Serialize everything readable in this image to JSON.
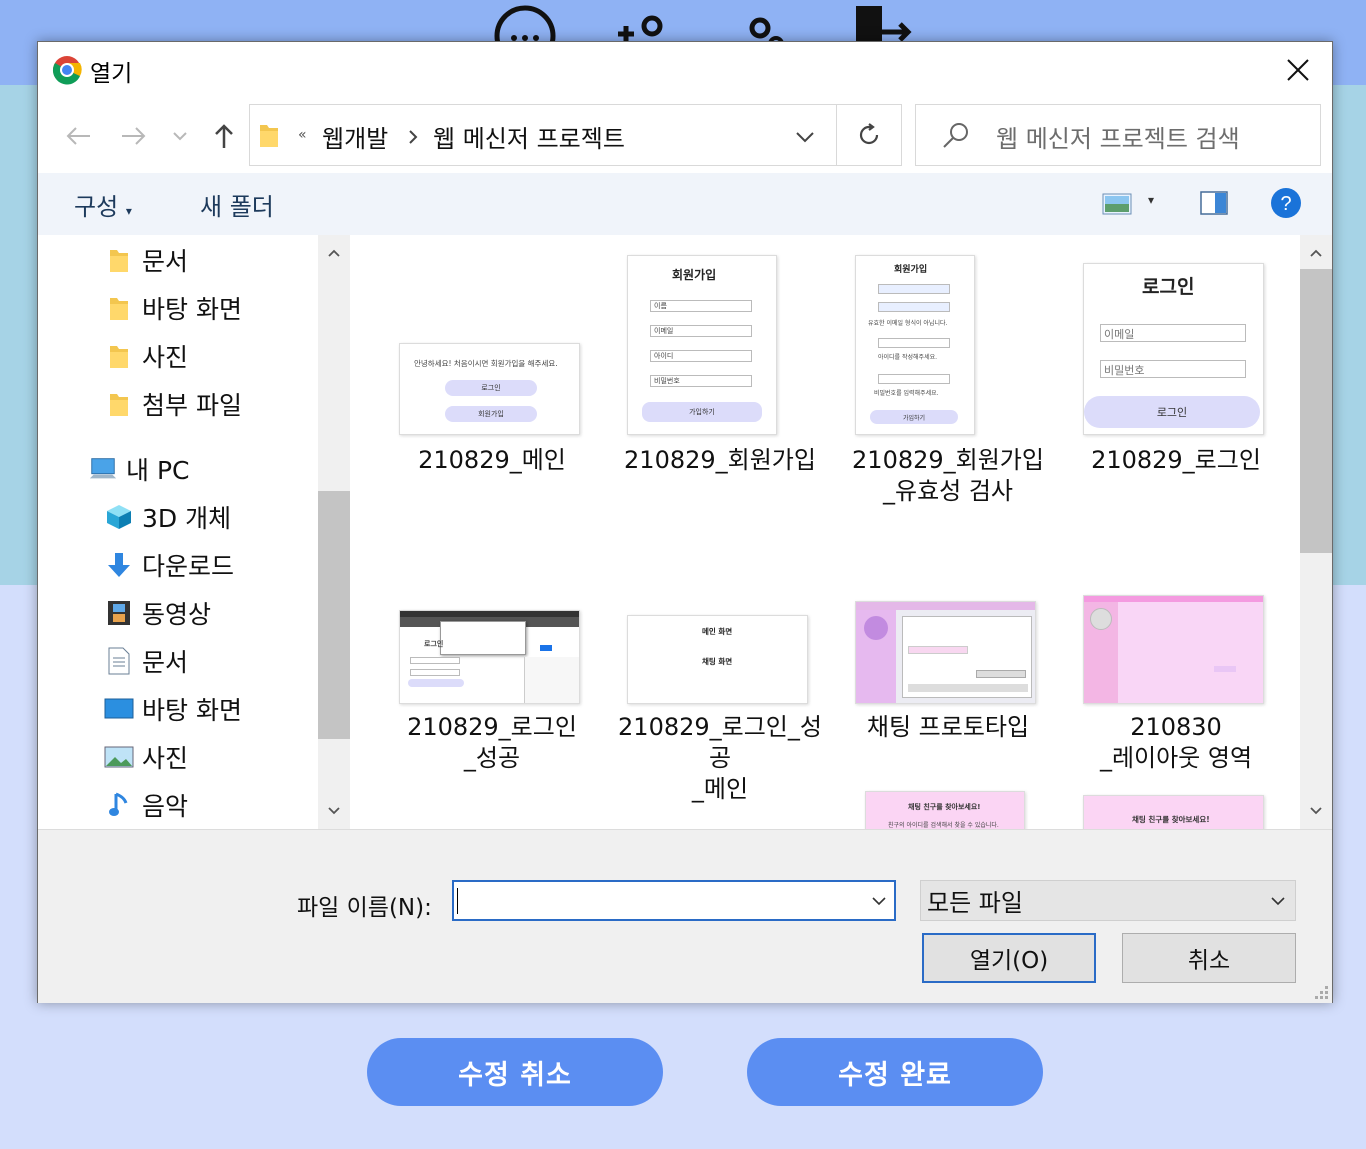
{
  "background": {
    "icons": [
      "chat-bubble-icon",
      "add-friend-icon",
      "user-settings-icon",
      "logout-icon"
    ],
    "buttons": {
      "cancel_edit": "수정 취소",
      "complete_edit": "수정 완료"
    }
  },
  "dialog": {
    "title": "열기",
    "breadcrumb": {
      "overflow": "«",
      "parent": "웹개발",
      "current": "웹 메신저 프로젝트"
    },
    "search_placeholder": "웹 메신저 프로젝트 검색",
    "commands": {
      "organize": "구성",
      "new_folder": "새 폴더"
    },
    "nav_items": {
      "documents_quick": "문서",
      "desktop_quick": "바탕 화면",
      "pictures_quick": "사진",
      "attachments": "첨부 파일",
      "this_pc": "내 PC",
      "objects_3d": "3D 개체",
      "downloads": "다운로드",
      "videos": "동영상",
      "documents": "문서",
      "desktop": "바탕 화면",
      "pictures": "사진",
      "music": "음악"
    },
    "files": [
      {
        "name": "210829_메인",
        "thumb": "main"
      },
      {
        "name": "210829_회원가입",
        "thumb": "signup"
      },
      {
        "name": "210829_회원가입_유효성 검사",
        "thumb": "signup-validation"
      },
      {
        "name": "210829_로그인",
        "thumb": "login"
      },
      {
        "name": "210829_로그인_성공",
        "thumb": "login-success"
      },
      {
        "name": "210829_로그인_성공_메인",
        "thumb": "login-success-main"
      },
      {
        "name": "채팅 프로토타입",
        "thumb": "chat-prototype"
      },
      {
        "name": "210830_레이아웃 영역",
        "thumb": "layout-area"
      },
      {
        "name": "",
        "thumb": "find-friend-1"
      },
      {
        "name": "",
        "thumb": "find-friend-2"
      }
    ],
    "thumb_text": {
      "main_welcome": "안녕하세요! 처음이시면 회원가입을 해주세요.",
      "login": "로그인",
      "signup": "회원가입",
      "name": "이름",
      "email": "이메일",
      "id": "아이디",
      "password": "비밀번호",
      "do_signup": "가입하기",
      "invalid_email": "유효한 이메일 형식이 아닙니다.",
      "enter_id": "아이디를 작성해주세요.",
      "enter_pw": "비밀번호를 입력해주세요.",
      "main_screen": "메인 화면",
      "chat_screen": "채팅 화면",
      "find_friend": "채팅 친구를 찾아보세요!",
      "find_friend_sub": "친구의 아이디를 검색해서 찾을 수 있습니다."
    },
    "file_name_label": "파일 이름(N):",
    "file_name_value": "",
    "file_type": "모든 파일",
    "open_button": "열기(O)",
    "cancel_button": "취소"
  },
  "colors": {
    "accent_button": "#5b8ef2",
    "focus_border": "#2a6bc6",
    "help_blue": "#1a73d9"
  }
}
